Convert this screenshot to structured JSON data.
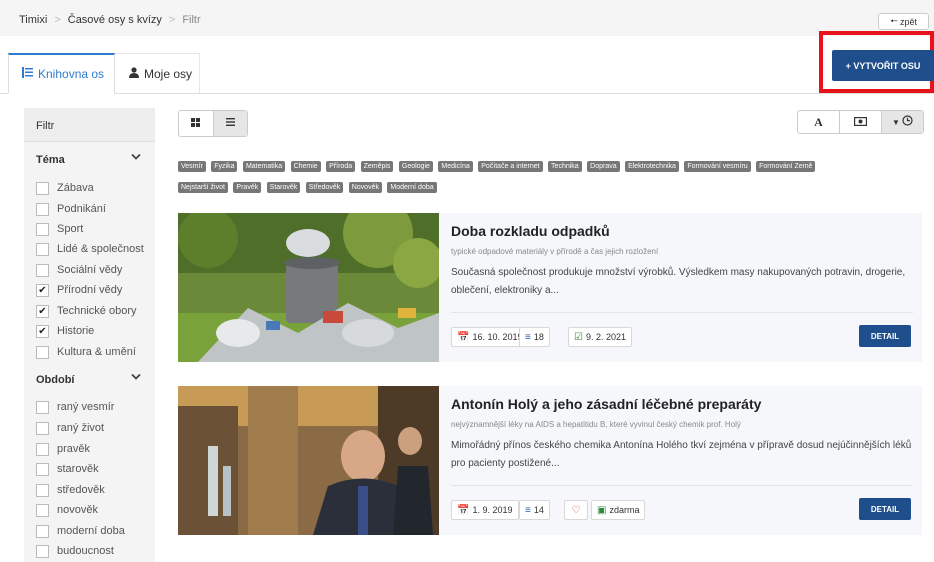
{
  "breadcrumb": {
    "items": [
      "Timixi",
      "Časové osy s kvízy",
      "Filtr"
    ]
  },
  "back_button": {
    "icon": "arrow-left-icon",
    "label": "zpět"
  },
  "tabs": [
    {
      "label": "Knihovna os",
      "icon": "list-icon",
      "active": true
    },
    {
      "label": "Moje osy",
      "icon": "user-icon",
      "active": false
    }
  ],
  "create_button": {
    "label": "+ VYTVOŘIT OSU",
    "highlight_color": "#e8121b"
  },
  "sidebar": {
    "header": "Filtr",
    "groups": [
      {
        "title": "Téma",
        "items": [
          {
            "label": "Zábava",
            "checked": false
          },
          {
            "label": "Podnikání",
            "checked": false
          },
          {
            "label": "Sport",
            "checked": false
          },
          {
            "label": "Lidé & společnost",
            "checked": false
          },
          {
            "label": "Sociální vědy",
            "checked": false
          },
          {
            "label": "Přírodní vědy",
            "checked": true
          },
          {
            "label": "Technické obory",
            "checked": true
          },
          {
            "label": "Historie",
            "checked": true
          },
          {
            "label": "Kultura & umění",
            "checked": false
          }
        ]
      },
      {
        "title": "Období",
        "items": [
          {
            "label": "raný vesmír",
            "checked": false
          },
          {
            "label": "raný život",
            "checked": false
          },
          {
            "label": "pravěk",
            "checked": false
          },
          {
            "label": "starověk",
            "checked": false
          },
          {
            "label": "středověk",
            "checked": false
          },
          {
            "label": "novověk",
            "checked": false
          },
          {
            "label": "moderní doba",
            "checked": false
          },
          {
            "label": "budoucnost",
            "checked": false
          }
        ]
      }
    ]
  },
  "view_toggle": {
    "grid_icon": "grid-icon",
    "list_icon": "list-icon",
    "active": "list"
  },
  "sort_tools": {
    "alpha_label": "A",
    "price_icon": "money-icon",
    "time_icon": "clock-icon",
    "active": "time"
  },
  "tags": [
    "Vesmír",
    "Fyzika",
    "Matematika",
    "Chemie",
    "Příroda",
    "Zeměpis",
    "Geologie",
    "Medicína",
    "Počítače a internet",
    "Technika",
    "Doprava",
    "Elektrotechnika",
    "Formování vesmíru",
    "Formování Země",
    "Nejstarší život",
    "Pravěk",
    "Starověk",
    "Středověk",
    "Novověk",
    "Moderní doba"
  ],
  "cards": [
    {
      "title": "Doba rozkladu odpadků",
      "subtitle": "typické odpadové materiály v přírodě a čas jejich rozložení",
      "description": "Současná společnost produkuje množství výrobků. Výsledkem masy nakupovaných potravin, drogerie, oblečení, elektroniky a...",
      "date": "16. 10. 2019",
      "events": "18",
      "updated": "9. 2. 2021",
      "detail_label": "DETAIL"
    },
    {
      "title": "Antonín Holý a jeho zásadní léčebné preparáty",
      "subtitle": "nejvýznamnější léky na AIDS a hepatitidu B, které vyvinul český chemik prof. Holý",
      "description": "Mimořádný přínos českého chemika Antonína Holého tkví zejména v přípravě dosud nejúčinnějších léků pro pacienty postižené...",
      "date": "1. 9. 2019",
      "events": "14",
      "price": "zdarma",
      "detail_label": "DETAIL"
    }
  ]
}
